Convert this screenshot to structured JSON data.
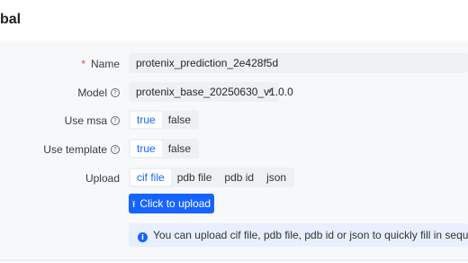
{
  "header": {
    "title": "bal"
  },
  "form": {
    "name": {
      "label": "Name",
      "required_mark": "*",
      "value": "protenix_prediction_2e428f5d"
    },
    "model": {
      "label": "Model",
      "value": "protenix_base_20250630_v1.0.0",
      "chevron_icon": "chevron-down-icon"
    },
    "use_msa": {
      "label": "Use msa",
      "options": [
        "true",
        "false"
      ],
      "selected": "true"
    },
    "use_template": {
      "label": "Use template",
      "options": [
        "true",
        "false"
      ],
      "selected": "true"
    },
    "upload": {
      "label": "Upload",
      "tabs": [
        "cif file",
        "pdb file",
        "pdb id",
        "json"
      ],
      "selected": "cif file",
      "button_label": "Click to upload",
      "button_icon": "upload-icon"
    },
    "info_text": "You can upload cif file, pdb file, pdb id or json to quickly fill in sequences, covalent bo",
    "help_icon": "question-circle-icon",
    "info_icon": "info-circle-icon"
  },
  "colors": {
    "primary": "#1664ff",
    "required": "#e5484d",
    "field_bg": "#eef0f3",
    "info_bg": "#e8f0ff"
  }
}
